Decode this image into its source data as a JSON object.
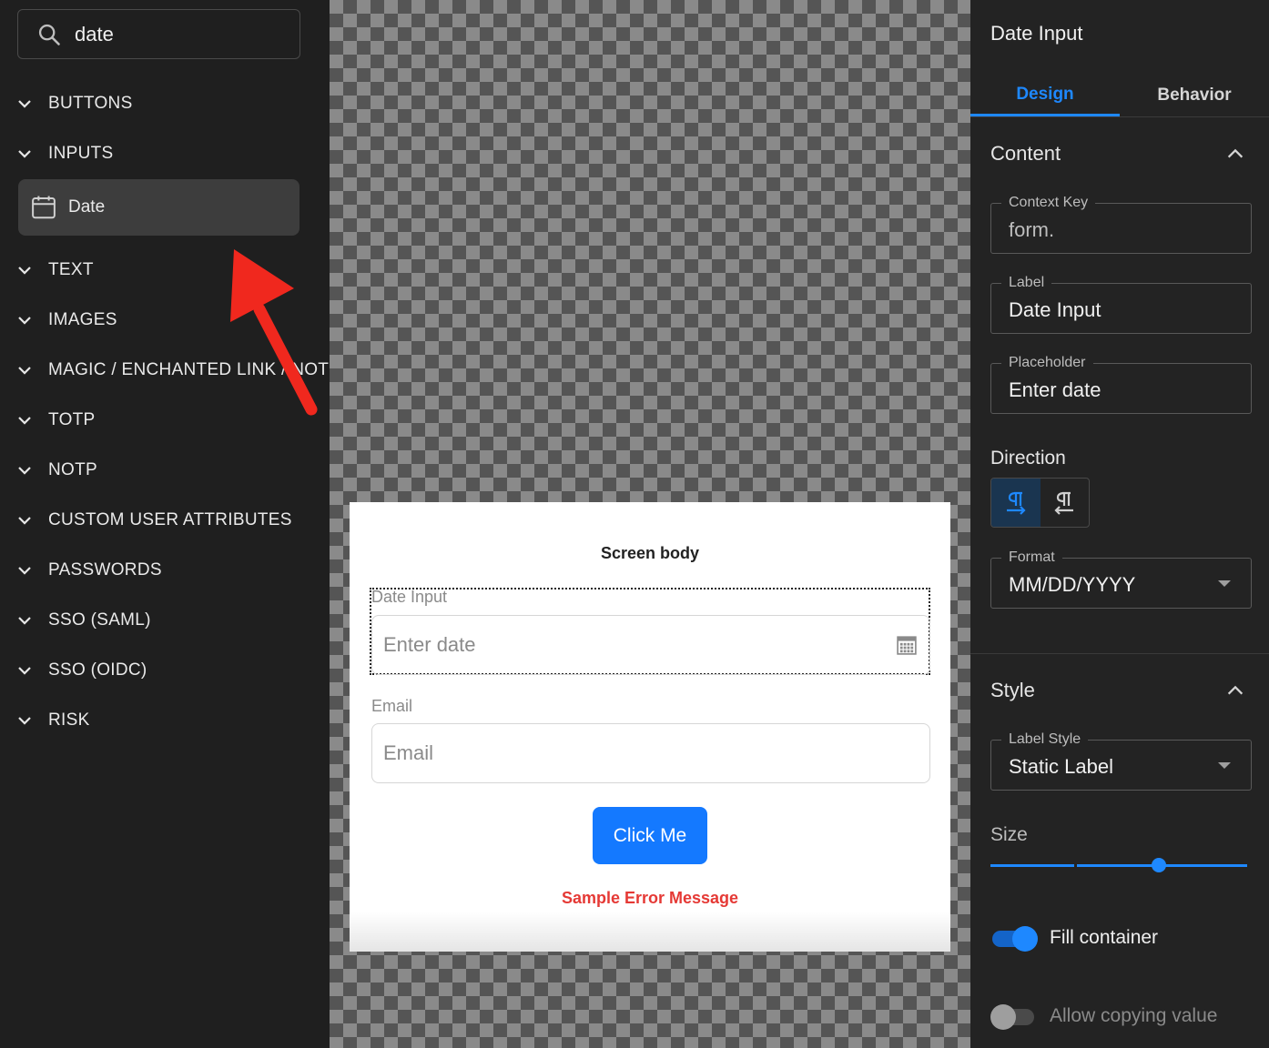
{
  "sidebar": {
    "search": {
      "value": "date"
    },
    "categories": {
      "buttons": "BUTTONS",
      "inputs": "INPUTS",
      "text": "TEXT",
      "images": "IMAGES",
      "magic": "MAGIC / ENCHANTED LINK / NOTP",
      "totp": "TOTP",
      "notp": "NOTP",
      "custom": "CUSTOM USER ATTRIBUTES",
      "passwords": "PASSWORDS",
      "saml": "SSO (SAML)",
      "oidc": "SSO (OIDC)",
      "risk": "RISK"
    },
    "date_item": "Date"
  },
  "canvas": {
    "screen_title": "Screen body",
    "date_label": "Date Input",
    "date_placeholder": "Enter date",
    "email_label": "Email",
    "email_placeholder": "Email",
    "button_label": "Click Me",
    "error_message": "Sample Error Message"
  },
  "panel": {
    "title": "Date Input",
    "tabs": {
      "design": "Design",
      "behavior": "Behavior"
    },
    "content": {
      "title": "Content",
      "context_key_label": "Context Key",
      "context_key_value": "form.",
      "label_label": "Label",
      "label_value": "Date Input",
      "placeholder_label": "Placeholder",
      "placeholder_value": "Enter date",
      "direction_label": "Direction",
      "format_label": "Format",
      "format_value": "MM/DD/YYYY"
    },
    "style": {
      "title": "Style",
      "label_style_label": "Label Style",
      "label_style_value": "Static Label",
      "size_label": "Size",
      "size_value": 0.65,
      "fill_container_label": "Fill container",
      "fill_container_on": true,
      "allow_copy_label": "Allow copying value",
      "allow_copy_on": false
    }
  },
  "colors": {
    "accent": "#1e88ff",
    "button": "#1479ff",
    "error": "#e53935",
    "annotation_arrow": "#f0281e"
  },
  "icons": [
    "search-icon",
    "chevron-down-icon",
    "calendar-icon",
    "chevron-up-icon",
    "ltr-direction-icon",
    "rtl-direction-icon",
    "dropdown-triangle-icon",
    "annotation-arrow-icon"
  ]
}
